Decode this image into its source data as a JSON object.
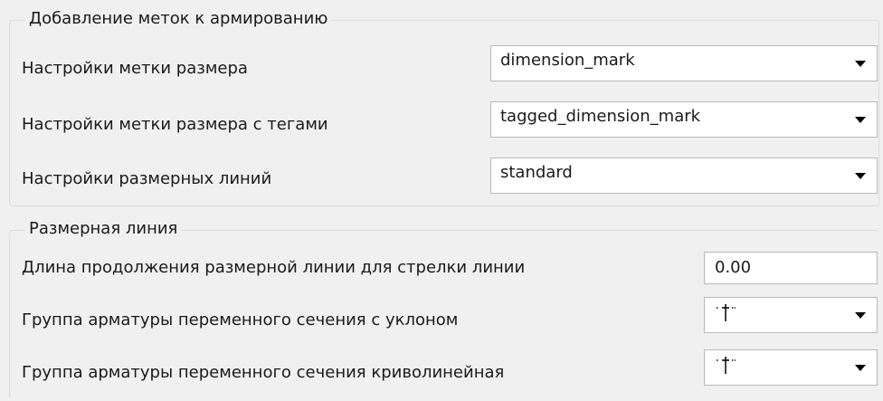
{
  "reinforcement_marks": {
    "title": "Добавление меток к армированию",
    "dimension_mark": {
      "label": "Настройки метки размера",
      "value": "dimension_mark"
    },
    "tagged_dimension_mark": {
      "label": "Настройки метки размера с тегами",
      "value": "tagged_dimension_mark"
    },
    "dimension_lines": {
      "label": "Настройки размерных линий",
      "value": "standard"
    }
  },
  "dimension_line": {
    "title": "Размерная линия",
    "extension_length": {
      "label": "Длина продолжения размерной линии для стрелки линии",
      "value": "0.00"
    },
    "variable_section_slope": {
      "label": "Группа арматуры переменного сечения с уклоном",
      "icon": "dimension-tick-glyph-icon"
    },
    "variable_section_curved": {
      "label": "Группа арматуры переменного сечения криволинейная",
      "icon": "dimension-tick-glyph-icon"
    }
  }
}
